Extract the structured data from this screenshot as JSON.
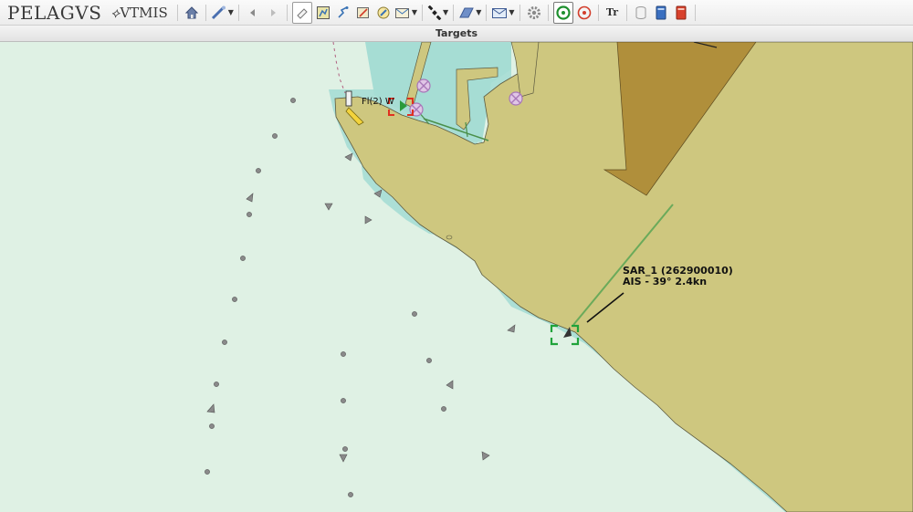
{
  "app": {
    "brand": "PELAGVS",
    "product": "VTMIS"
  },
  "toolbar": {
    "icons": [
      "home-icon",
      "measure-tool-icon",
      "back-arrow-icon",
      "forward-arrow-icon",
      "eraser-icon",
      "chart-layers-icon",
      "route-icon",
      "map-edit-icon",
      "edit-tool-icon",
      "message-icon",
      "satellite-icon",
      "area-tool-icon",
      "mail-icon",
      "settings-icon",
      "target-green-icon",
      "target-red-icon",
      "text-tool-icon",
      "cylinder-icon",
      "blue-book-icon",
      "red-book-icon"
    ],
    "text_tool_label": "Tr"
  },
  "targets_bar": {
    "title": "Targets"
  },
  "map": {
    "light_label": "Fl(2) W",
    "vessel": {
      "name_line": "SAR_1 (262900010)",
      "info_line": "AIS - 39° 2.4kn"
    }
  },
  "colors": {
    "sea": "#dff1e4",
    "shallow": "#a6ddd4",
    "land": "#cec77f",
    "dark_land": "#b08f3b",
    "selection_green": "#1fa33a",
    "selection_red": "#e03020"
  }
}
